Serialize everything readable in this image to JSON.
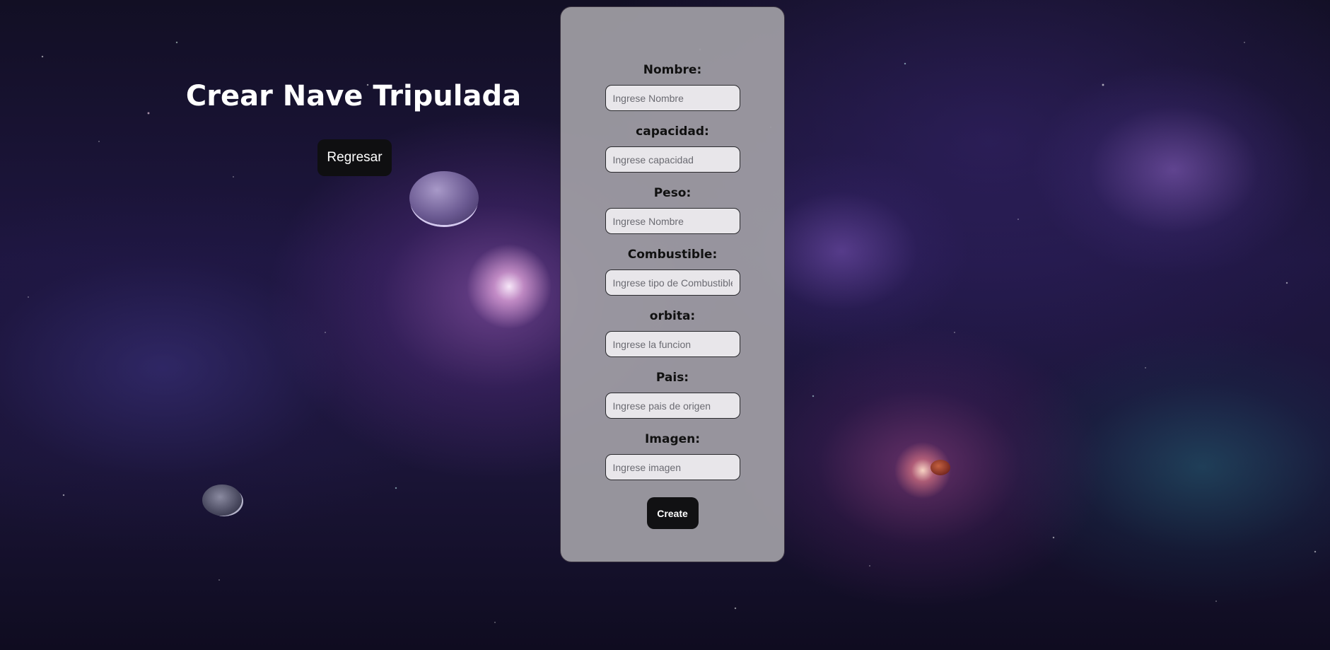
{
  "page": {
    "title": "Crear Nave Tripulada",
    "back_label": "Regresar"
  },
  "form": {
    "fields": [
      {
        "label": "Nombre:",
        "placeholder": "Ingrese Nombre",
        "value": ""
      },
      {
        "label": "capacidad:",
        "placeholder": "Ingrese capacidad",
        "value": ""
      },
      {
        "label": "Peso:",
        "placeholder": "Ingrese Nombre",
        "value": ""
      },
      {
        "label": "Combustible:",
        "placeholder": "Ingrese tipo de Combustible",
        "value": ""
      },
      {
        "label": "orbita:",
        "placeholder": "Ingrese la funcion",
        "value": ""
      },
      {
        "label": "Pais:",
        "placeholder": "Ingrese pais de origen",
        "value": ""
      },
      {
        "label": "Imagen:",
        "placeholder": "Ingrese imagen",
        "value": ""
      }
    ],
    "submit_label": "Create"
  },
  "colors": {
    "card_background": "#a09ea5",
    "button_background": "#111113",
    "title_text": "#ffffff"
  }
}
